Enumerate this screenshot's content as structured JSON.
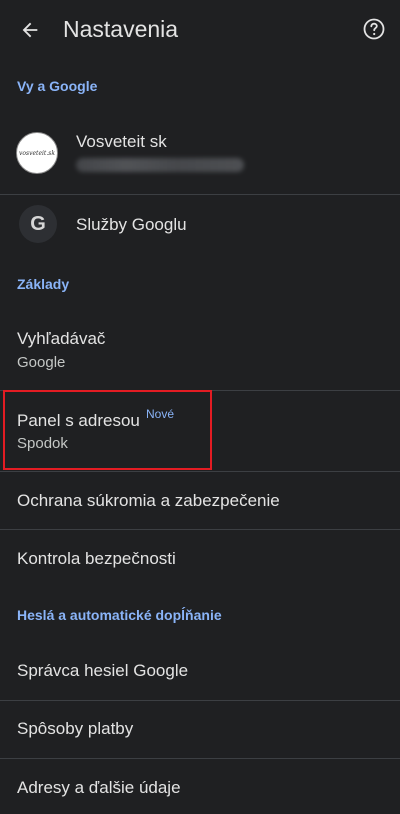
{
  "header": {
    "title": "Nastavenia"
  },
  "sections": {
    "you_and_google": "Vy a Google",
    "basics": "Základy",
    "passwords": "Heslá a automatické dopĺňanie"
  },
  "account": {
    "name": "Vosveteit sk",
    "avatar_text": "vosveteit.sk"
  },
  "rows": {
    "google_services": "Služby Googlu",
    "search_engine": {
      "title": "Vyhľadávač",
      "subtitle": "Google"
    },
    "address_bar": {
      "title": "Panel s adresou",
      "subtitle": "Spodok",
      "badge": "Nové"
    },
    "privacy": "Ochrana súkromia a zabezpečenie",
    "safety_check": "Kontrola bezpečnosti",
    "password_manager": "Správca hesiel Google",
    "payment_methods": "Spôsoby platby",
    "addresses": "Adresy a ďalšie údaje"
  },
  "icons": {
    "back": "arrow-back-icon",
    "help": "help-icon",
    "google": "google-g-icon"
  },
  "colors": {
    "background": "#1f2022",
    "accent": "#8ab4f8",
    "highlight": "#e31c23"
  }
}
